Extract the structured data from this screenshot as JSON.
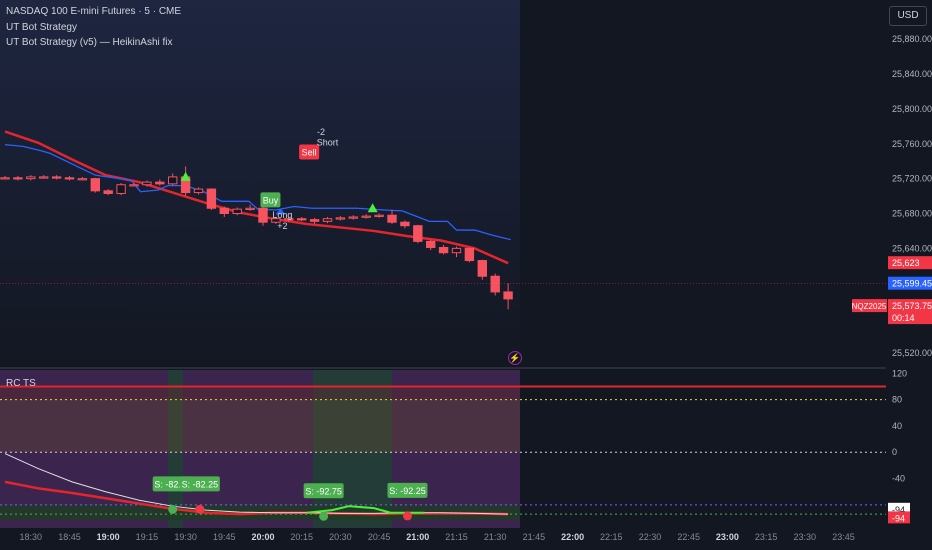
{
  "header": {
    "symbol_line": "NASDAQ 100 E-mini Futures · 5 · CME",
    "study_1": "UT Bot Strategy",
    "study_2": "UT Bot Strategy (v5) — HeikinAshi fix",
    "currency_button": "USD"
  },
  "indicator": {
    "name": "RC TS"
  },
  "colors": {
    "background": "#131722",
    "bull": "#f7525f",
    "bear": "#f7525f",
    "trend_red": "#e3252c",
    "trail_blue": "#2962ff",
    "signal_green": "#4caf50",
    "price_tag_red": "#f23645",
    "price_tag_blue": "#2962ff"
  },
  "icons": {
    "alert": "lightning-icon"
  },
  "chart_data": [
    {
      "type": "candlestick",
      "title": "",
      "x_ticks": [
        "18:30",
        "18:45",
        "19:00",
        "19:15",
        "19:30",
        "19:45",
        "20:00",
        "20:15",
        "20:30",
        "20:45",
        "21:00",
        "21:15",
        "21:30",
        "21:45",
        "22:00",
        "22:15",
        "22:30",
        "22:45",
        "23:00",
        "23:15",
        "23:30",
        "23:45"
      ],
      "y_ticks": [
        "25,880.00",
        "25,840.00",
        "25,800.00",
        "25,760.00",
        "25,720.00",
        "25,680.00",
        "25,640.00",
        "25,520.00"
      ],
      "ylim": [
        25505,
        25925
      ],
      "candles": [
        {
          "t": "18:20",
          "o": 25721,
          "c": 25721,
          "h": 25723,
          "l": 25719
        },
        {
          "t": "18:25",
          "o": 25721,
          "c": 25720,
          "h": 25723,
          "l": 25718
        },
        {
          "t": "18:30",
          "o": 25720,
          "c": 25722,
          "h": 25724,
          "l": 25718
        },
        {
          "t": "18:35",
          "o": 25722,
          "c": 25722,
          "h": 25724,
          "l": 25720
        },
        {
          "t": "18:40",
          "o": 25722,
          "c": 25721,
          "h": 25724,
          "l": 25719
        },
        {
          "t": "18:45",
          "o": 25721,
          "c": 25720,
          "h": 25723,
          "l": 25718
        },
        {
          "t": "18:50",
          "o": 25720,
          "c": 25720,
          "h": 25722,
          "l": 25718
        },
        {
          "t": "18:55",
          "o": 25720,
          "c": 25706,
          "h": 25721,
          "l": 25704
        },
        {
          "t": "19:00",
          "o": 25706,
          "c": 25703,
          "h": 25708,
          "l": 25701
        },
        {
          "t": "19:05",
          "o": 25703,
          "c": 25713,
          "h": 25715,
          "l": 25701
        },
        {
          "t": "19:10",
          "o": 25713,
          "c": 25713,
          "h": 25715,
          "l": 25711
        },
        {
          "t": "19:15",
          "o": 25713,
          "c": 25716,
          "h": 25718,
          "l": 25711
        },
        {
          "t": "19:20",
          "o": 25716,
          "c": 25714,
          "h": 25719,
          "l": 25712
        },
        {
          "t": "19:25",
          "o": 25714,
          "c": 25722,
          "h": 25726,
          "l": 25712
        },
        {
          "t": "19:30",
          "o": 25722,
          "c": 25704,
          "h": 25734,
          "l": 25700
        },
        {
          "t": "19:35",
          "o": 25704,
          "c": 25708,
          "h": 25710,
          "l": 25702
        },
        {
          "t": "19:40",
          "o": 25708,
          "c": 25686,
          "h": 25709,
          "l": 25684
        },
        {
          "t": "19:45",
          "o": 25686,
          "c": 25680,
          "h": 25688,
          "l": 25676
        },
        {
          "t": "19:50",
          "o": 25680,
          "c": 25685,
          "h": 25687,
          "l": 25678
        },
        {
          "t": "19:55",
          "o": 25685,
          "c": 25686,
          "h": 25690,
          "l": 25683
        },
        {
          "t": "20:00",
          "o": 25686,
          "c": 25670,
          "h": 25687,
          "l": 25666
        },
        {
          "t": "20:05",
          "o": 25670,
          "c": 25674,
          "h": 25676,
          "l": 25668
        },
        {
          "t": "20:10",
          "o": 25674,
          "c": 25674,
          "h": 25676,
          "l": 25670
        },
        {
          "t": "20:15",
          "o": 25674,
          "c": 25673,
          "h": 25676,
          "l": 25671
        },
        {
          "t": "20:20",
          "o": 25673,
          "c": 25671,
          "h": 25675,
          "l": 25668
        },
        {
          "t": "20:25",
          "o": 25671,
          "c": 25674,
          "h": 25676,
          "l": 25669
        },
        {
          "t": "20:30",
          "o": 25674,
          "c": 25675,
          "h": 25677,
          "l": 25672
        },
        {
          "t": "20:35",
          "o": 25675,
          "c": 25676,
          "h": 25678,
          "l": 25673
        },
        {
          "t": "20:40",
          "o": 25676,
          "c": 25677,
          "h": 25679,
          "l": 25674
        },
        {
          "t": "20:45",
          "o": 25677,
          "c": 25678,
          "h": 25680,
          "l": 25675
        },
        {
          "t": "20:50",
          "o": 25678,
          "c": 25670,
          "h": 25684,
          "l": 25668
        },
        {
          "t": "20:55",
          "o": 25670,
          "c": 25666,
          "h": 25672,
          "l": 25663
        },
        {
          "t": "21:00",
          "o": 25666,
          "c": 25648,
          "h": 25667,
          "l": 25646
        },
        {
          "t": "21:05",
          "o": 25648,
          "c": 25641,
          "h": 25650,
          "l": 25638
        },
        {
          "t": "21:10",
          "o": 25641,
          "c": 25635,
          "h": 25644,
          "l": 25633
        },
        {
          "t": "21:15",
          "o": 25635,
          "c": 25640,
          "h": 25642,
          "l": 25630
        },
        {
          "t": "21:20",
          "o": 25640,
          "c": 25626,
          "h": 25641,
          "l": 25624
        },
        {
          "t": "21:25",
          "o": 25626,
          "c": 25608,
          "h": 25627,
          "l": 25604
        },
        {
          "t": "21:30",
          "o": 25608,
          "c": 25590,
          "h": 25611,
          "l": 25586
        },
        {
          "t": "21:35",
          "o": 25590,
          "c": 25582,
          "h": 25600,
          "l": 25570
        }
      ],
      "trend_line": [
        [
          0,
          25774
        ],
        [
          4,
          25761
        ],
        [
          8,
          25742
        ],
        [
          12,
          25724
        ],
        [
          16,
          25716
        ],
        [
          20,
          25704
        ],
        [
          24,
          25692
        ],
        [
          28,
          25681
        ],
        [
          32,
          25674
        ],
        [
          36,
          25668
        ],
        [
          40,
          25664
        ],
        [
          44,
          25660
        ],
        [
          48,
          25654
        ],
        [
          52,
          25649
        ],
        [
          56,
          25640
        ],
        [
          60,
          25623
        ]
      ],
      "trail_line": [
        [
          0,
          25759
        ],
        [
          2,
          25757
        ],
        [
          4,
          25752
        ],
        [
          5,
          25749
        ],
        [
          10,
          25724
        ],
        [
          14,
          25718
        ],
        [
          15,
          25705
        ],
        [
          17,
          25707
        ],
        [
          18,
          25712
        ],
        [
          20,
          25712
        ],
        [
          22,
          25705
        ],
        [
          24,
          25694
        ],
        [
          27,
          25694
        ],
        [
          28,
          25685
        ],
        [
          30,
          25684
        ],
        [
          32,
          25688
        ],
        [
          34,
          25686
        ],
        [
          39,
          25686
        ],
        [
          42,
          25684
        ],
        [
          44,
          25683
        ],
        [
          47,
          25671
        ],
        [
          49,
          25671
        ],
        [
          50,
          25661
        ],
        [
          52,
          25661
        ],
        [
          54,
          25655
        ],
        [
          56,
          25650
        ]
      ],
      "signals": [
        {
          "label": "Buy",
          "kind": "buy",
          "x": 20.5,
          "y": 25695
        },
        {
          "label": "Long",
          "kind": "buy-text",
          "x": 21.5,
          "y": 25675
        },
        {
          "label": "+2",
          "kind": "buy-text",
          "x": 21.5,
          "y": 25662
        },
        {
          "label": "Sell",
          "kind": "sell",
          "x": 23.5,
          "y": 25750
        },
        {
          "label": "-2",
          "kind": "sell-text",
          "x": 24.5,
          "y": 25770
        },
        {
          "label": "Short",
          "kind": "sell-text",
          "x": 25,
          "y": 25758
        }
      ],
      "price_tags": [
        {
          "label": "25,623",
          "color": "#f23645"
        },
        {
          "label": "25,599.45",
          "color": "#2962ff"
        },
        {
          "label": "25,573.75",
          "color": "#f23645"
        },
        {
          "label": "00:14",
          "color": "#f23645"
        },
        {
          "label": "NQZ2025",
          "color": "#f23645"
        }
      ]
    },
    {
      "type": "line",
      "title": "RC TS",
      "y_ticks": [
        "120",
        "80",
        "40",
        "0",
        "-40"
      ],
      "ylim": [
        -103,
        125
      ],
      "levels": [
        {
          "value": 100,
          "color": "#e3252c"
        },
        {
          "value": 80,
          "color": "#f0d43a"
        },
        {
          "value": 0,
          "color": "#d1d4dc"
        },
        {
          "value": -80,
          "color": "#7b61ff"
        },
        {
          "value": -94,
          "color": "#4caf50"
        }
      ],
      "series": [
        {
          "color": "#e3252c",
          "values": [
            [
              0,
              -45
            ],
            [
              4,
              -55
            ],
            [
              8,
              -62
            ],
            [
              12,
              -70
            ],
            [
              16,
              -78
            ],
            [
              20,
              -86
            ],
            [
              24,
              -92
            ],
            [
              28,
              -94
            ],
            [
              32,
              -92
            ],
            [
              36,
              -92
            ],
            [
              40,
              -93
            ],
            [
              44,
              -94
            ],
            [
              48,
              -93
            ],
            [
              52,
              -93
            ],
            [
              56,
              -93
            ],
            [
              60,
              -94
            ]
          ]
        },
        {
          "color": "#e0e0e0",
          "values": [
            [
              0,
              -2
            ],
            [
              4,
              -25
            ],
            [
              8,
              -45
            ],
            [
              12,
              -60
            ],
            [
              16,
              -73
            ],
            [
              20,
              -82
            ],
            [
              24,
              -88
            ],
            [
              28,
              -91
            ],
            [
              32,
              -92
            ],
            [
              36,
              -92
            ],
            [
              40,
              -93
            ],
            [
              44,
              -93
            ],
            [
              48,
              -92
            ],
            [
              52,
              -92
            ],
            [
              56,
              -93
            ],
            [
              60,
              -94
            ]
          ]
        },
        {
          "color": "#4cf03c",
          "values": [
            [
              36,
              -92
            ],
            [
              39,
              -88
            ],
            [
              41,
              -82
            ],
            [
              44,
              -85
            ],
            [
              46,
              -92
            ],
            [
              50,
              -92
            ]
          ]
        }
      ],
      "markers": [
        {
          "label": "S: -82.25",
          "x": 20,
          "y": -82.25
        },
        {
          "label": "S: -82.25",
          "x": 23,
          "y": -82.25
        },
        {
          "label": "S: -92.75",
          "x": 38,
          "y": -92.75
        },
        {
          "label": "S: -92.25",
          "x": 48,
          "y": -92.25
        }
      ],
      "value_tags": [
        {
          "label": "-94",
          "color": "#ffffff",
          "text": "#131722"
        },
        {
          "label": "-94",
          "color": "#f23645",
          "text": "#ffffff"
        }
      ]
    }
  ]
}
